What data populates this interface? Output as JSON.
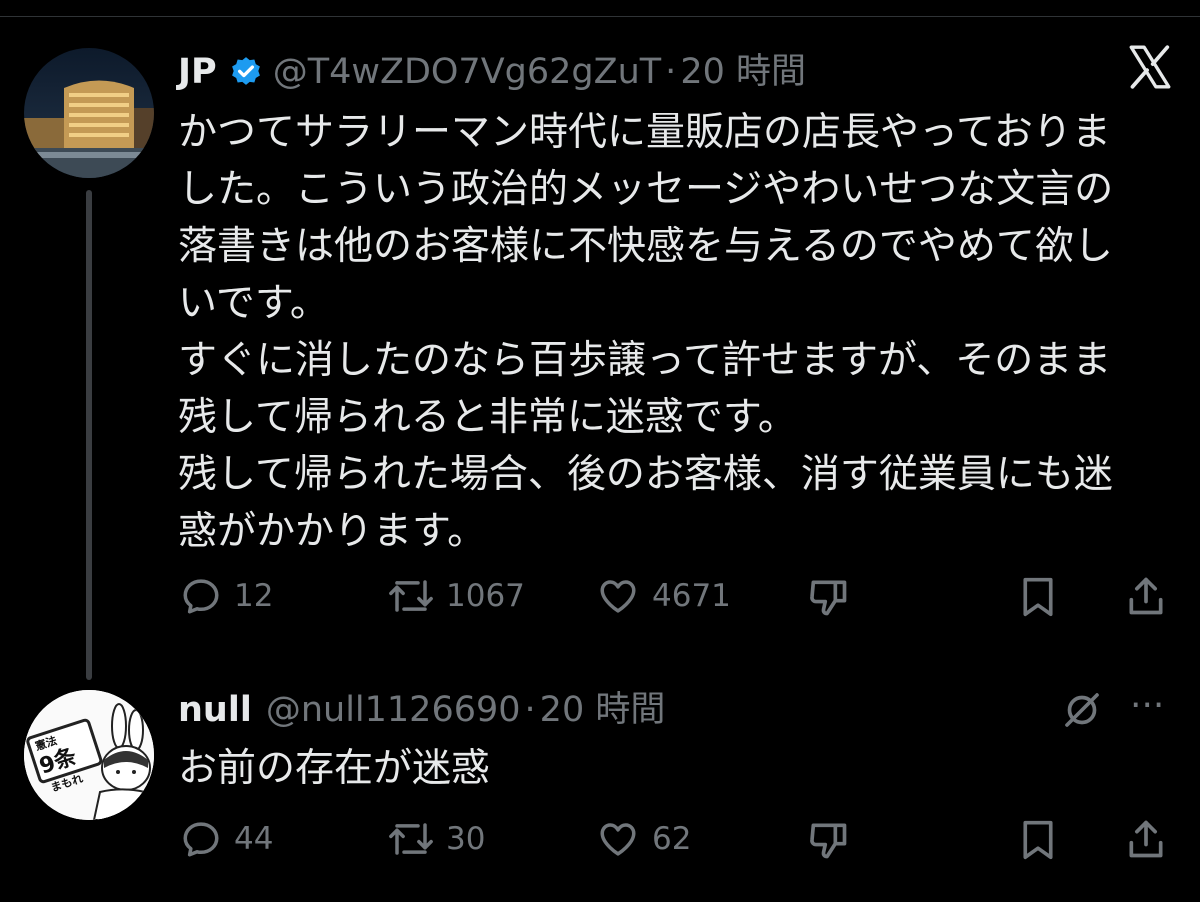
{
  "tweet": {
    "author_name": "JP",
    "handle": "@T4wZDO7Vg62gZuT",
    "separator": "·",
    "time": "20 時間",
    "text": "かつてサラリーマン時代に量販店の店長やっておりま\nした。こういう政治的メッセージやわいせつな文言の\n落書きは他のお客様に不快感を与えるのでやめて欲し\nいです。\nすぐに消したのなら百歩譲って許せますが、そのまま\n残して帰られると非常に迷惑です。\n残して帰られた場合、後のお客様、消す従業員にも迷\n惑がかかります。",
    "replies": "12",
    "reposts": "1067",
    "likes": "4671"
  },
  "reply": {
    "author_name": "null",
    "handle": "@null1126690",
    "separator": "·",
    "time": "20 時間",
    "text": "お前の存在が迷惑",
    "replies": "44",
    "reposts": "30",
    "likes": "62",
    "more_label": "···"
  },
  "avatar_sticker_text": {
    "small": "憲法",
    "big": "9条",
    "bottom": "まもれ"
  },
  "colors": {
    "background": "#000000",
    "text": "#e7e9ea",
    "muted": "#71767b",
    "verified": "#1d9bf0",
    "thread_line": "#3a3d41"
  },
  "icons": [
    "x-logo-icon",
    "verified-badge-icon",
    "reply-icon",
    "repost-icon",
    "like-icon",
    "dislike-icon",
    "bookmark-icon",
    "share-icon",
    "grok-icon",
    "more-icon"
  ]
}
